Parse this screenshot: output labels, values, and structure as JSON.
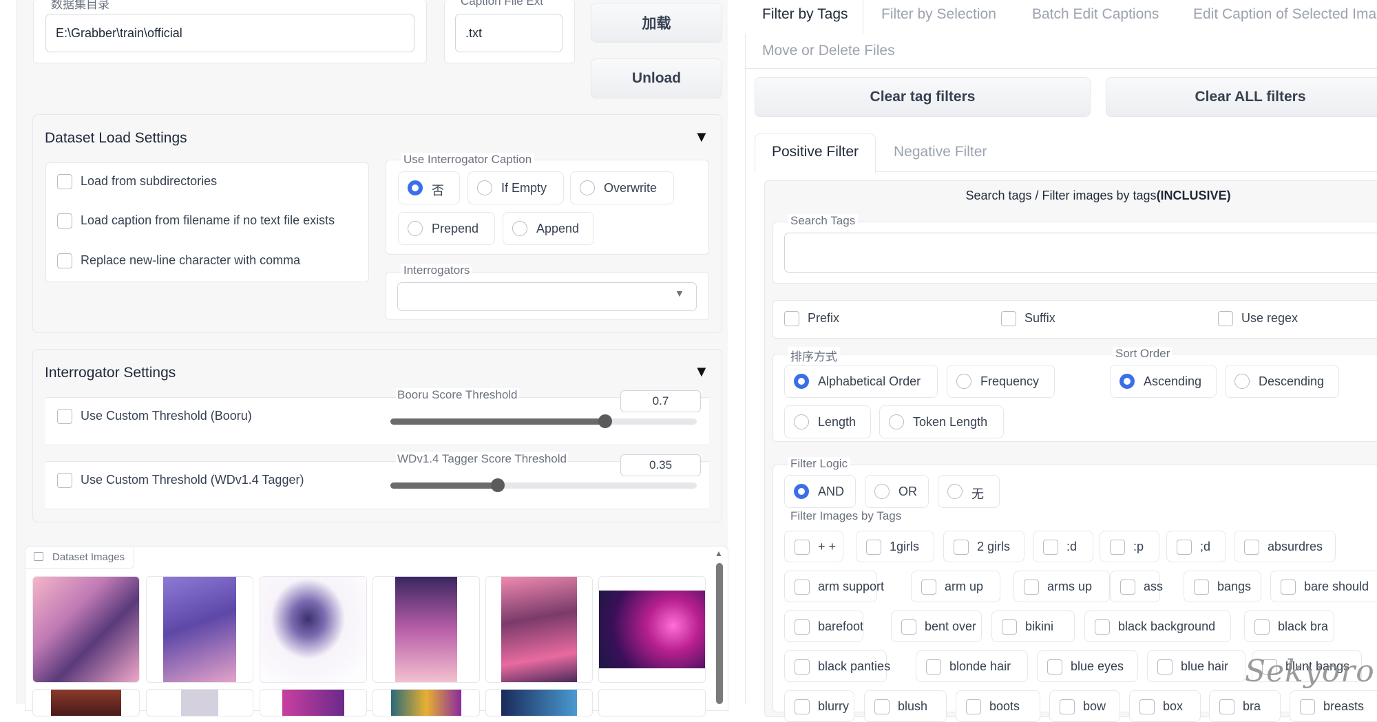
{
  "left": {
    "dataset_dir": {
      "label": "数据集目录",
      "value": "E:\\Grabber\\train\\official"
    },
    "caption_ext": {
      "label": "Caption File Ext",
      "value": ".txt"
    },
    "load_button": "加载",
    "unload_button": "Unload",
    "load_settings": {
      "title": "Dataset Load Settings",
      "checkboxes": [
        "Load from subdirectories",
        "Load caption from filename if no text file exists",
        "Replace new-line character with comma"
      ],
      "interrogator_caption": {
        "label": "Use Interrogator Caption",
        "options": [
          "否",
          "If Empty",
          "Overwrite",
          "Prepend",
          "Append"
        ],
        "selected": "否"
      },
      "interrogators": {
        "label": "Interrogators",
        "value": ""
      }
    },
    "interrogator_settings": {
      "title": "Interrogator Settings",
      "booru": {
        "checkbox": "Use Custom Threshold (Booru)",
        "slider_label": "Booru Score Threshold",
        "value": "0.7",
        "fraction": 0.7
      },
      "wd": {
        "checkbox": "Use Custom Threshold (WDv1.4 Tagger)",
        "slider_label": "WDv1.4 Tagger Score Threshold",
        "value": "0.35",
        "fraction": 0.35
      }
    },
    "gallery": {
      "label": "Dataset Images"
    }
  },
  "right": {
    "tabs": [
      "Filter by Tags",
      "Filter by Selection",
      "Batch Edit Captions",
      "Edit Caption of Selected Ima",
      "Move or Delete Files"
    ],
    "active_tab": "Filter by Tags",
    "clear_tag_filters": "Clear tag filters",
    "clear_all_filters": "Clear ALL filters",
    "filter_tabs": [
      "Positive Filter",
      "Negative Filter"
    ],
    "heading_prefix": "Search tags / Filter images by tags",
    "heading_bold": "(INCLUSIVE)",
    "search_tags_label": "Search Tags",
    "search_value": "",
    "options": [
      "Prefix",
      "Suffix",
      "Use regex"
    ],
    "sort_by": {
      "label": "排序方式",
      "options": [
        "Alphabetical Order",
        "Frequency",
        "Length",
        "Token Length"
      ],
      "selected": "Alphabetical Order"
    },
    "sort_order": {
      "label": "Sort Order",
      "options": [
        "Ascending",
        "Descending"
      ],
      "selected": "Ascending"
    },
    "filter_logic": {
      "label": "Filter Logic",
      "options": [
        "AND",
        "OR",
        "无"
      ],
      "selected": "AND"
    },
    "filter_images_label": "Filter Images by Tags",
    "tags": [
      "+ +",
      "1girls",
      "2 girls",
      ":d",
      ":p",
      ";d",
      "absurdres",
      "arm support",
      "arm up",
      "arms up",
      "ass",
      "bangs",
      "bare should",
      "barefoot",
      "bent over",
      "bikini",
      "black background",
      "black bra",
      "black panties",
      "blonde hair",
      "blue eyes",
      "blue hair",
      "blunt bangs",
      "blurry",
      "blush",
      "boots",
      "bow",
      "box",
      "bra",
      "breasts"
    ]
  },
  "watermark": "Sekyoro",
  "colors": {
    "accent": "#3b6fe8",
    "border": "#e5e7eb",
    "panel": "#f7f7f8"
  }
}
